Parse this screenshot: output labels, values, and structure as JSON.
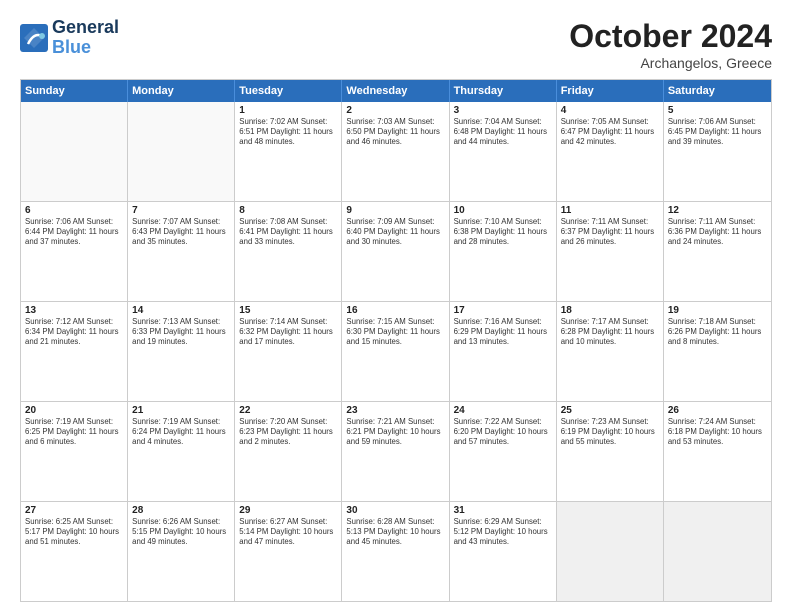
{
  "header": {
    "logo_line1": "General",
    "logo_line2": "Blue",
    "month": "October 2024",
    "location": "Archangelos, Greece"
  },
  "weekdays": [
    "Sunday",
    "Monday",
    "Tuesday",
    "Wednesday",
    "Thursday",
    "Friday",
    "Saturday"
  ],
  "rows": [
    [
      {
        "day": "",
        "info": "",
        "empty": true
      },
      {
        "day": "",
        "info": "",
        "empty": true
      },
      {
        "day": "1",
        "info": "Sunrise: 7:02 AM\nSunset: 6:51 PM\nDaylight: 11 hours and 48 minutes."
      },
      {
        "day": "2",
        "info": "Sunrise: 7:03 AM\nSunset: 6:50 PM\nDaylight: 11 hours and 46 minutes."
      },
      {
        "day": "3",
        "info": "Sunrise: 7:04 AM\nSunset: 6:48 PM\nDaylight: 11 hours and 44 minutes."
      },
      {
        "day": "4",
        "info": "Sunrise: 7:05 AM\nSunset: 6:47 PM\nDaylight: 11 hours and 42 minutes."
      },
      {
        "day": "5",
        "info": "Sunrise: 7:06 AM\nSunset: 6:45 PM\nDaylight: 11 hours and 39 minutes."
      }
    ],
    [
      {
        "day": "6",
        "info": "Sunrise: 7:06 AM\nSunset: 6:44 PM\nDaylight: 11 hours and 37 minutes."
      },
      {
        "day": "7",
        "info": "Sunrise: 7:07 AM\nSunset: 6:43 PM\nDaylight: 11 hours and 35 minutes."
      },
      {
        "day": "8",
        "info": "Sunrise: 7:08 AM\nSunset: 6:41 PM\nDaylight: 11 hours and 33 minutes."
      },
      {
        "day": "9",
        "info": "Sunrise: 7:09 AM\nSunset: 6:40 PM\nDaylight: 11 hours and 30 minutes."
      },
      {
        "day": "10",
        "info": "Sunrise: 7:10 AM\nSunset: 6:38 PM\nDaylight: 11 hours and 28 minutes."
      },
      {
        "day": "11",
        "info": "Sunrise: 7:11 AM\nSunset: 6:37 PM\nDaylight: 11 hours and 26 minutes."
      },
      {
        "day": "12",
        "info": "Sunrise: 7:11 AM\nSunset: 6:36 PM\nDaylight: 11 hours and 24 minutes."
      }
    ],
    [
      {
        "day": "13",
        "info": "Sunrise: 7:12 AM\nSunset: 6:34 PM\nDaylight: 11 hours and 21 minutes."
      },
      {
        "day": "14",
        "info": "Sunrise: 7:13 AM\nSunset: 6:33 PM\nDaylight: 11 hours and 19 minutes."
      },
      {
        "day": "15",
        "info": "Sunrise: 7:14 AM\nSunset: 6:32 PM\nDaylight: 11 hours and 17 minutes."
      },
      {
        "day": "16",
        "info": "Sunrise: 7:15 AM\nSunset: 6:30 PM\nDaylight: 11 hours and 15 minutes."
      },
      {
        "day": "17",
        "info": "Sunrise: 7:16 AM\nSunset: 6:29 PM\nDaylight: 11 hours and 13 minutes."
      },
      {
        "day": "18",
        "info": "Sunrise: 7:17 AM\nSunset: 6:28 PM\nDaylight: 11 hours and 10 minutes."
      },
      {
        "day": "19",
        "info": "Sunrise: 7:18 AM\nSunset: 6:26 PM\nDaylight: 11 hours and 8 minutes."
      }
    ],
    [
      {
        "day": "20",
        "info": "Sunrise: 7:19 AM\nSunset: 6:25 PM\nDaylight: 11 hours and 6 minutes."
      },
      {
        "day": "21",
        "info": "Sunrise: 7:19 AM\nSunset: 6:24 PM\nDaylight: 11 hours and 4 minutes."
      },
      {
        "day": "22",
        "info": "Sunrise: 7:20 AM\nSunset: 6:23 PM\nDaylight: 11 hours and 2 minutes."
      },
      {
        "day": "23",
        "info": "Sunrise: 7:21 AM\nSunset: 6:21 PM\nDaylight: 10 hours and 59 minutes."
      },
      {
        "day": "24",
        "info": "Sunrise: 7:22 AM\nSunset: 6:20 PM\nDaylight: 10 hours and 57 minutes."
      },
      {
        "day": "25",
        "info": "Sunrise: 7:23 AM\nSunset: 6:19 PM\nDaylight: 10 hours and 55 minutes."
      },
      {
        "day": "26",
        "info": "Sunrise: 7:24 AM\nSunset: 6:18 PM\nDaylight: 10 hours and 53 minutes."
      }
    ],
    [
      {
        "day": "27",
        "info": "Sunrise: 6:25 AM\nSunset: 5:17 PM\nDaylight: 10 hours and 51 minutes."
      },
      {
        "day": "28",
        "info": "Sunrise: 6:26 AM\nSunset: 5:15 PM\nDaylight: 10 hours and 49 minutes."
      },
      {
        "day": "29",
        "info": "Sunrise: 6:27 AM\nSunset: 5:14 PM\nDaylight: 10 hours and 47 minutes."
      },
      {
        "day": "30",
        "info": "Sunrise: 6:28 AM\nSunset: 5:13 PM\nDaylight: 10 hours and 45 minutes."
      },
      {
        "day": "31",
        "info": "Sunrise: 6:29 AM\nSunset: 5:12 PM\nDaylight: 10 hours and 43 minutes."
      },
      {
        "day": "",
        "info": "",
        "empty": true,
        "shaded": true
      },
      {
        "day": "",
        "info": "",
        "empty": true,
        "shaded": true
      }
    ]
  ]
}
